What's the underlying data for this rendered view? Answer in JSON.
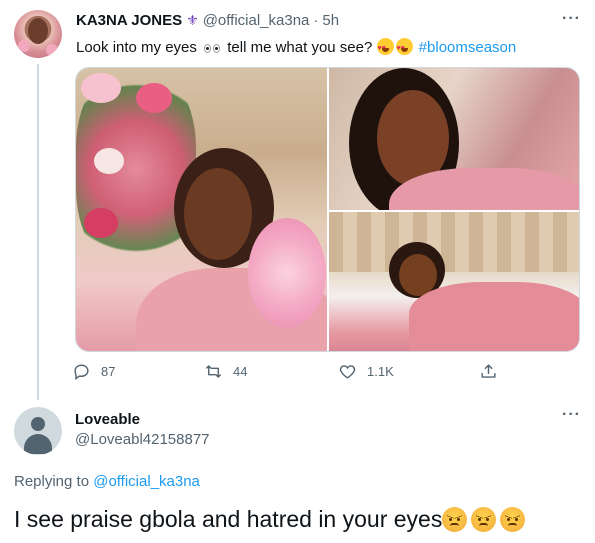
{
  "tweet": {
    "author_name": "KA3NA JONES",
    "author_badge": "⚜",
    "author_handle": "@official_ka3na",
    "separator": "·",
    "time": "5h",
    "more": "···",
    "text_before": "Look into my eyes",
    "text_middle": "tell me what you see?",
    "hashtag": "#bloomseason",
    "emoji_eyes": "eyes-emoji",
    "emoji_heart_eyes": "heart-eyes-emoji",
    "photos": [
      "photo-portrait-flowers",
      "photo-closeup-portrait",
      "photo-lying-on-bed"
    ],
    "actions": {
      "replies": "87",
      "retweets": "44",
      "likes": "1.1K"
    }
  },
  "reply": {
    "author_name": "Loveable",
    "author_handle": "@Loveabl42158877",
    "more": "···",
    "replying_prefix": "Replying to",
    "replying_to": "@official_ka3na",
    "text": "I see praise gbola and hatred in your eyes",
    "emoji": "angry-face-emoji",
    "emoji_count": 3
  },
  "colors": {
    "link": "#1d9bf0",
    "secondary_text": "#536471",
    "primary_text": "#0f1419",
    "thread_line": "#cfd9de"
  }
}
